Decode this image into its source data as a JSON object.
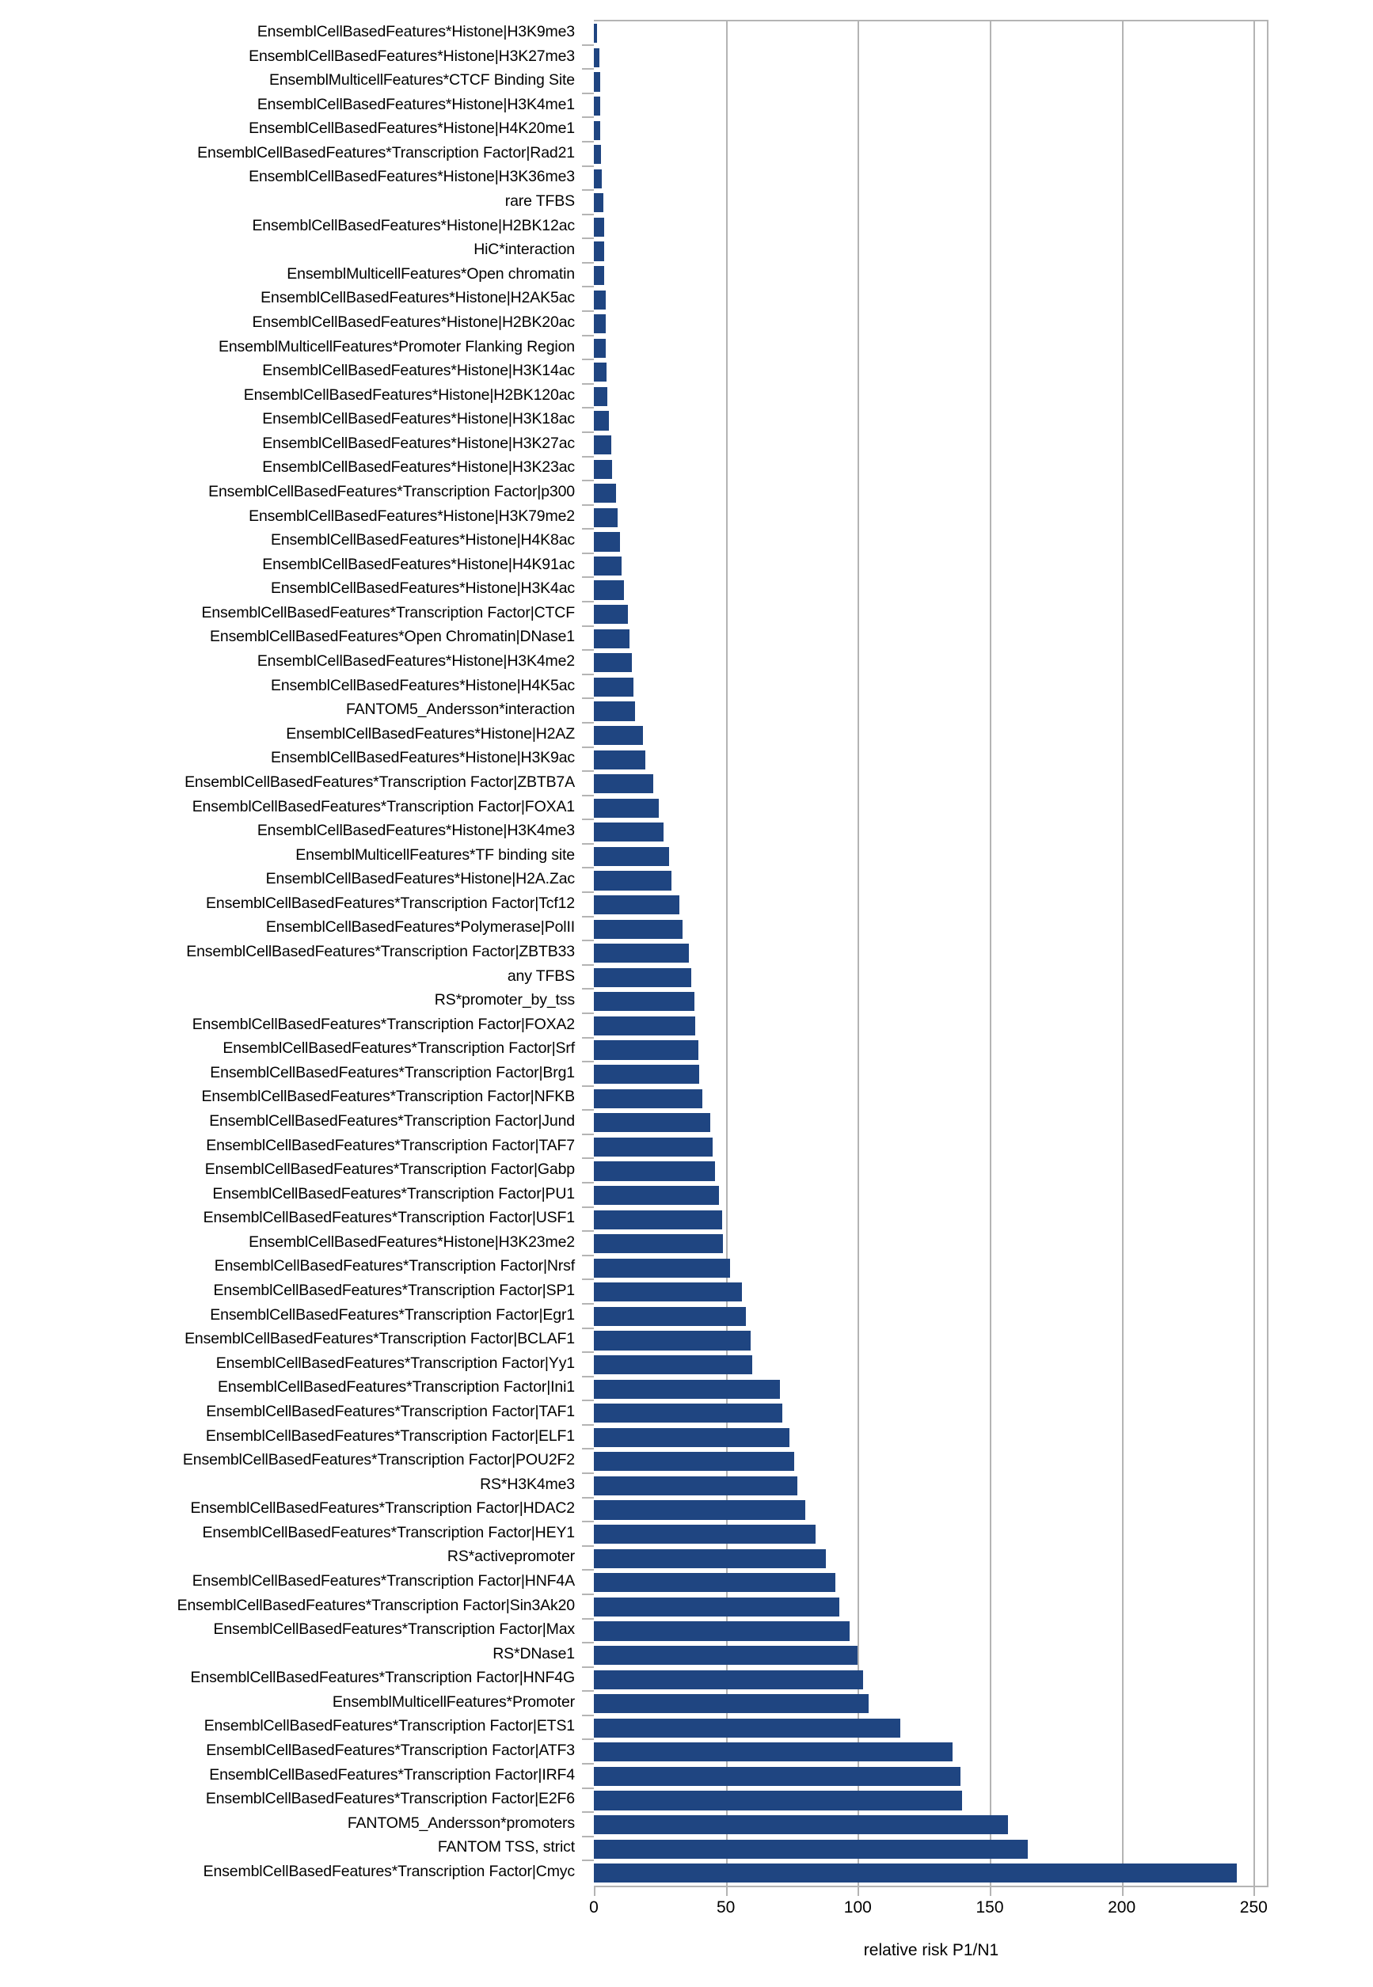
{
  "chart_data": {
    "type": "bar",
    "orientation": "horizontal",
    "title": "",
    "xlabel": "relative risk P1/N1",
    "ylabel": "",
    "xlim": [
      0,
      255
    ],
    "xticks": [
      0,
      50,
      100,
      150,
      200,
      250
    ],
    "xtick_labels": [
      "0",
      "50",
      "100",
      "150",
      "200",
      "250"
    ],
    "grid": true,
    "grid_axis": "x",
    "bar_color": "#1f4581",
    "legend": null,
    "categories": [
      "EnsemblCellBasedFeatures*Histone|H3K9me3",
      "EnsemblCellBasedFeatures*Histone|H3K27me3",
      "EnsemblMulticellFeatures*CTCF Binding Site",
      "EnsemblCellBasedFeatures*Histone|H3K4me1",
      "EnsemblCellBasedFeatures*Histone|H4K20me1",
      "EnsemblCellBasedFeatures*Transcription Factor|Rad21",
      "EnsemblCellBasedFeatures*Histone|H3K36me3",
      "rare TFBS",
      "EnsemblCellBasedFeatures*Histone|H2BK12ac",
      "HiC*interaction",
      "EnsemblMulticellFeatures*Open chromatin",
      "EnsemblCellBasedFeatures*Histone|H2AK5ac",
      "EnsemblCellBasedFeatures*Histone|H2BK20ac",
      "EnsemblMulticellFeatures*Promoter Flanking Region",
      "EnsemblCellBasedFeatures*Histone|H3K14ac",
      "EnsemblCellBasedFeatures*Histone|H2BK120ac",
      "EnsemblCellBasedFeatures*Histone|H3K18ac",
      "EnsemblCellBasedFeatures*Histone|H3K27ac",
      "EnsemblCellBasedFeatures*Histone|H3K23ac",
      "EnsemblCellBasedFeatures*Transcription Factor|p300",
      "EnsemblCellBasedFeatures*Histone|H3K79me2",
      "EnsemblCellBasedFeatures*Histone|H4K8ac",
      "EnsemblCellBasedFeatures*Histone|H4K91ac",
      "EnsemblCellBasedFeatures*Histone|H3K4ac",
      "EnsemblCellBasedFeatures*Transcription Factor|CTCF",
      "EnsemblCellBasedFeatures*Open Chromatin|DNase1",
      "EnsemblCellBasedFeatures*Histone|H3K4me2",
      "EnsemblCellBasedFeatures*Histone|H4K5ac",
      "FANTOM5_Andersson*interaction",
      "EnsemblCellBasedFeatures*Histone|H2AZ",
      "EnsemblCellBasedFeatures*Histone|H3K9ac",
      "EnsemblCellBasedFeatures*Transcription Factor|ZBTB7A",
      "EnsemblCellBasedFeatures*Transcription Factor|FOXA1",
      "EnsemblCellBasedFeatures*Histone|H3K4me3",
      "EnsemblMulticellFeatures*TF binding site",
      "EnsemblCellBasedFeatures*Histone|H2A.Zac",
      "EnsemblCellBasedFeatures*Transcription Factor|Tcf12",
      "EnsemblCellBasedFeatures*Polymerase|PolII",
      "EnsemblCellBasedFeatures*Transcription Factor|ZBTB33",
      "any TFBS",
      "RS*promoter_by_tss",
      "EnsemblCellBasedFeatures*Transcription Factor|FOXA2",
      "EnsemblCellBasedFeatures*Transcription Factor|Srf",
      "EnsemblCellBasedFeatures*Transcription Factor|Brg1",
      "EnsemblCellBasedFeatures*Transcription Factor|NFKB",
      "EnsemblCellBasedFeatures*Transcription Factor|Jund",
      "EnsemblCellBasedFeatures*Transcription Factor|TAF7",
      "EnsemblCellBasedFeatures*Transcription Factor|Gabp",
      "EnsemblCellBasedFeatures*Transcription Factor|PU1",
      "EnsemblCellBasedFeatures*Transcription Factor|USF1",
      "EnsemblCellBasedFeatures*Histone|H3K23me2",
      "EnsemblCellBasedFeatures*Transcription Factor|Nrsf",
      "EnsemblCellBasedFeatures*Transcription Factor|SP1",
      "EnsemblCellBasedFeatures*Transcription Factor|Egr1",
      "EnsemblCellBasedFeatures*Transcription Factor|BCLAF1",
      "EnsemblCellBasedFeatures*Transcription Factor|Yy1",
      "EnsemblCellBasedFeatures*Transcription Factor|Ini1",
      "EnsemblCellBasedFeatures*Transcription Factor|TAF1",
      "EnsemblCellBasedFeatures*Transcription Factor|ELF1",
      "EnsemblCellBasedFeatures*Transcription Factor|POU2F2",
      "RS*H3K4me3",
      "EnsemblCellBasedFeatures*Transcription Factor|HDAC2",
      "EnsemblCellBasedFeatures*Transcription Factor|HEY1",
      "RS*activepromoter",
      "EnsemblCellBasedFeatures*Transcription Factor|HNF4A",
      "EnsemblCellBasedFeatures*Transcription Factor|Sin3Ak20",
      "EnsemblCellBasedFeatures*Transcription Factor|Max",
      "RS*DNase1",
      "EnsemblCellBasedFeatures*Transcription Factor|HNF4G",
      "EnsemblMulticellFeatures*Promoter",
      "EnsemblCellBasedFeatures*Transcription Factor|ETS1",
      "EnsemblCellBasedFeatures*Transcription Factor|ATF3",
      "EnsemblCellBasedFeatures*Transcription Factor|IRF4",
      "EnsemblCellBasedFeatures*Transcription Factor|E2F6",
      "FANTOM5_Andersson*promoters",
      "FANTOM TSS, strict",
      "EnsemblCellBasedFeatures*Transcription Factor|Cmyc"
    ],
    "values": [
      1.2,
      2.0,
      2.3,
      2.4,
      2.5,
      2.7,
      2.9,
      3.5,
      3.8,
      3.9,
      4.0,
      4.4,
      4.5,
      4.6,
      4.8,
      5.0,
      5.6,
      6.6,
      7.0,
      8.5,
      9.0,
      9.8,
      10.5,
      11.5,
      13.0,
      13.5,
      14.5,
      15.0,
      15.5,
      18.5,
      19.5,
      22.5,
      24.5,
      26.5,
      28.5,
      29.5,
      32.5,
      33.5,
      36.0,
      36.8,
      38.0,
      38.5,
      39.5,
      40.0,
      41.0,
      44.0,
      45.0,
      46.0,
      47.5,
      48.5,
      48.8,
      51.5,
      56.0,
      57.5,
      59.5,
      60.0,
      70.5,
      71.5,
      74.0,
      76.0,
      77.0,
      80.0,
      84.0,
      88.0,
      91.5,
      93.0,
      97.0,
      100.0,
      102.0,
      104.0,
      116.0,
      136.0,
      139.0,
      139.5,
      157.0,
      164.5,
      243.5
    ]
  }
}
